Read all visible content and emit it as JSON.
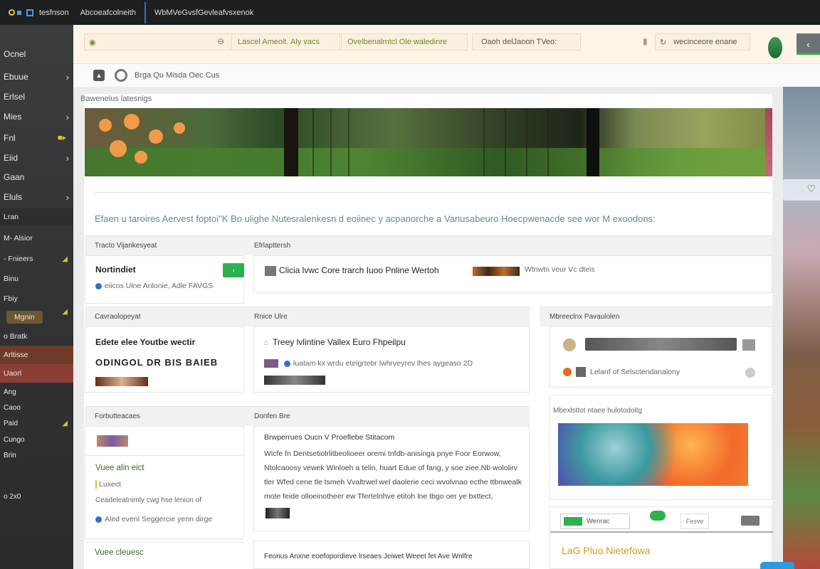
{
  "window": {
    "tab1": "tesfnson",
    "tab2": "Abcoeafcolneith",
    "tab3": "WbMVeGvsfGevleafvsxenok"
  },
  "sidebar": {
    "items": [
      {
        "label": "Ocnel",
        "chevron": ""
      },
      {
        "label": "Ebuue",
        "chevron": "›"
      },
      {
        "label": "Erlsel",
        "chevron": ""
      },
      {
        "label": "Mies",
        "chevron": "›"
      },
      {
        "label": "Fnl",
        "chevron": ""
      },
      {
        "label": "Eiid",
        "chevron": "›"
      },
      {
        "label": "Gaan",
        "chevron": ""
      },
      {
        "label": "Eluls",
        "chevron": "›"
      },
      {
        "label": "Lran",
        "chevron": ""
      },
      {
        "label": "M- Alsior",
        "chevron": ""
      },
      {
        "label": "- Fnieers",
        "chevron": ""
      },
      {
        "label": "Binu",
        "chevron": ""
      },
      {
        "label": "Fbiy",
        "chevron": ""
      },
      {
        "label": "Mgnin",
        "chevron": ""
      },
      {
        "label": "o Bratk",
        "chevron": ""
      },
      {
        "label": "Arltisse",
        "chevron": ""
      },
      {
        "label": "Uaorl",
        "chevron": ""
      },
      {
        "label": "Ang",
        "chevron": ""
      },
      {
        "label": "Caoo",
        "chevron": ""
      },
      {
        "label": "Paid",
        "chevron": ""
      },
      {
        "label": "Cungo",
        "chevron": ""
      },
      {
        "label": "Brin",
        "chevron": ""
      },
      {
        "label": "o 2x0",
        "chevron": ""
      }
    ]
  },
  "toolbar": {
    "box1": "Lascel Ameolt. Aly vacs",
    "box2": "Ovelbenalmtcl Ole waledinre",
    "box3": "Oaoh delJaoon TVeo:",
    "box4": "wecinceore enane"
  },
  "breadcrumb": {
    "text": "Brga Qu  Misda Oec Cus"
  },
  "hero": {
    "caption": "Bawenelus latesnigs"
  },
  "main": {
    "headline": "Efaen u taroires Aervest foptoi\"K Bo ulighe Nutesralenkesn d eoiinec y acpanorche a Vanusabeuro Hoecpwenacde see wor M exoodons:",
    "s1": {
      "head": "Tracto Vijankesyeat",
      "title": "Nortindiet",
      "btn": "›",
      "line": "eiicos Ulne Anlonie, Adle FAVGS"
    },
    "s2": {
      "head": "Efrlapttersh",
      "line": "Clicia lvwc Core trarch  Iuoo Pnline Wertoh",
      "tail": "Wtnwtn veur Vc dteis"
    },
    "s3": {
      "head": "Cavraolopeyat",
      "title": "Edete elee Youtbe wectir",
      "sub": "ODINGOL DR BIS BAIEB"
    },
    "s4": {
      "head": "Rnice Ulre",
      "title": "Treey lvlintine Vallex Euro Fhpeilpu",
      "line": "luatam kx wrdu eteigrtebr lwhrveyrev lhes aygeaso 2D"
    },
    "s5": {
      "head": "Mbreeclnx Pavaulolen",
      "row2": "Lelanf of Selsctendanalony"
    },
    "s6": {
      "head": "Forbutteacaes",
      "title": "Vuee alin eict",
      "sub": "Luxect",
      "line1": "Ceadeleatnimly cwg hse lenion of",
      "line2": "Aled evenl Seggercie yenn dirge"
    },
    "s7": {
      "head": "Donfen Bre",
      "title": "Brwperrues Oucn V Proeflebe Stitacom",
      "para": "Wicfe fn Dentsetiolrlitbeolioeer oremi tnfdb-anisinga pnye Foor Eorwow, Ntolcaoosy vewek Winloeh a telin, huart Edue of fang, y soe ziee.Nb wololirv tler Wfed cene tle tsmeh Vvaltrwel wel daolerie ceci wvolvnao ecthe ttbnwealk mote feide olloeinotheer ew Tfertelnhve etitoh lne tbgo oer ye bxttect,"
    },
    "s8": {
      "head": "Mbexlsttot ntaee hulotodoltg"
    },
    "s9": {
      "head": "Vuee cleuesc",
      "line": "Feonus Anxne eoefopordieve lrseaes Jeiwet Weeet fet Ave Wnlfre"
    },
    "s10": {
      "chip1": "Wenrac",
      "chip2": "Fesve",
      "title": "LaG Pluo Nietefowa"
    }
  },
  "colors": {
    "accent_green": "#2bb24c",
    "topbar_bg": "#1e1f20",
    "sidebar_bg": "#33353a",
    "headline_blue": "#5d8a9a"
  }
}
